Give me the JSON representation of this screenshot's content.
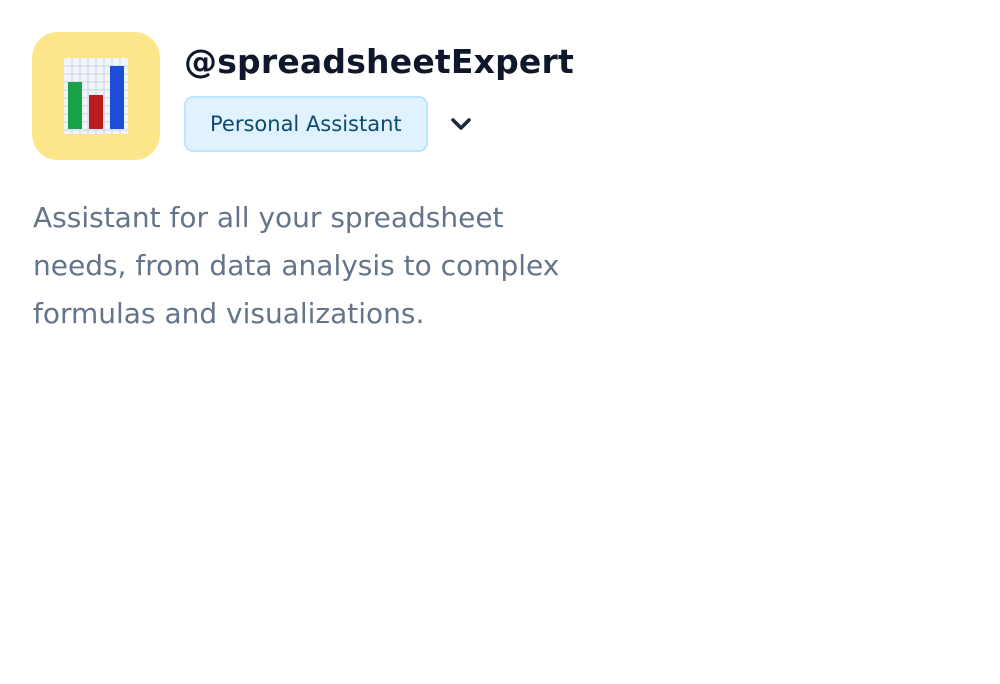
{
  "profile": {
    "handle": "@spreadsheetExpert",
    "role_label": "Personal Assistant",
    "description": "Assistant for all your spreadsheet needs, from data analysis to complex formulas and visualizations.",
    "avatar_icon": "bar-chart-icon",
    "dropdown_icon": "chevron-down-icon"
  },
  "colors": {
    "avatar_bg": "#fde68a",
    "chart_paper": "#f1f5f9",
    "chart_grid": "#c7d2e0",
    "bar_green": "#16a34a",
    "bar_red": "#b91c1c",
    "bar_blue": "#1d4ed8",
    "handle": "#0f172a",
    "badge_bg": "#e0f2fe",
    "badge_border": "#bae6fd",
    "badge_text": "#0c4a6e",
    "chevron": "#1e293b",
    "description": "#64748b"
  }
}
